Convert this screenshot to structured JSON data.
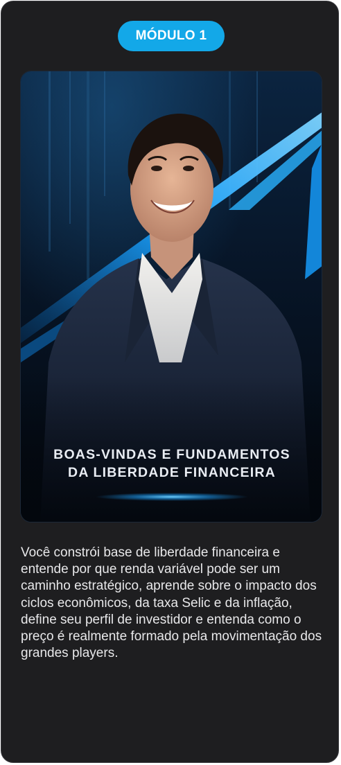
{
  "module": {
    "badge_label": "MÓDULO 1",
    "cover_title_line1": "BOAS-VINDAS E FUNDAMENTOS",
    "cover_title_line2": "DA LIBERDADE FINANCEIRA",
    "description": "Você constrói base de liberdade financeira e entende por que renda variável pode ser um caminho estratégico, aprende sobre o impacto dos ciclos econômicos, da taxa Selic e da inflação, define seu perfil de investidor e entenda como o preço é realmente formado pela movimentação dos grandes players."
  },
  "colors": {
    "card_background": "#1e1e20",
    "badge_background": "#13a8e8",
    "accent_blue": "#1aa3ff",
    "cover_background": "#06101e",
    "text": "#e8e8ea"
  }
}
